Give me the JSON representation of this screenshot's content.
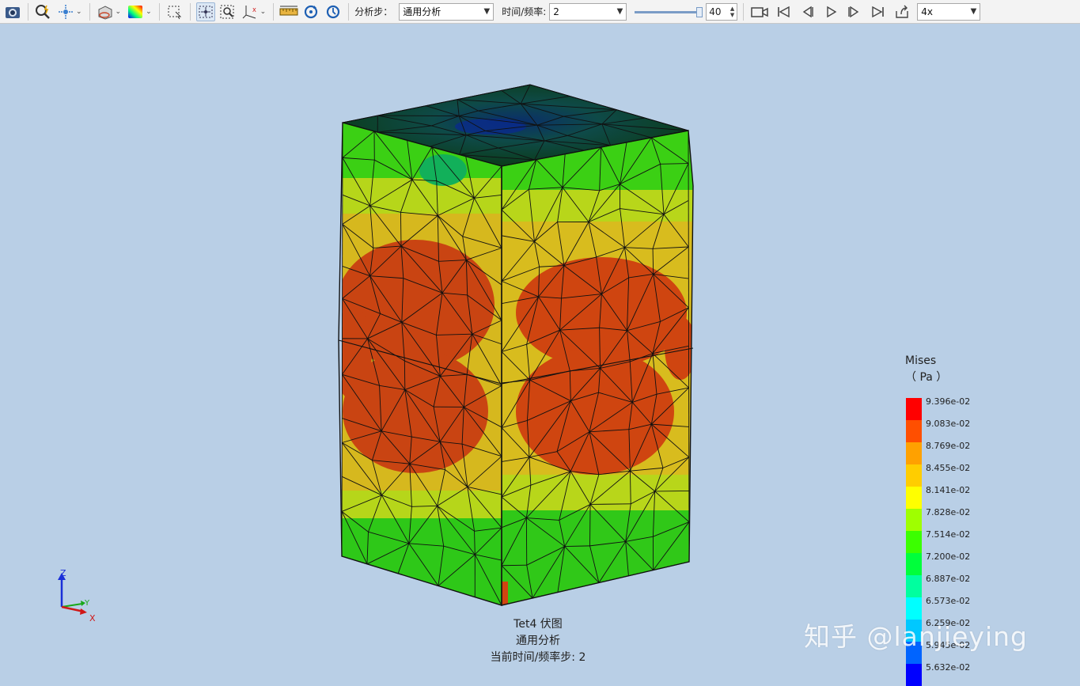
{
  "toolbar": {
    "analysis_step_label": "分析步：",
    "analysis_step_value": "通用分析",
    "time_freq_label": "时间/频率:",
    "time_freq_value": "2",
    "frame_count": "40",
    "frame_progress": 0.95,
    "speed_value": "4x"
  },
  "legend": {
    "title": "Mises",
    "unit": "（ Pa ）",
    "entries": [
      {
        "label": "9.396e-02",
        "color": "#ff0000"
      },
      {
        "label": "9.083e-02",
        "color": "#ff4f00"
      },
      {
        "label": "8.769e-02",
        "color": "#ffa100"
      },
      {
        "label": "8.455e-02",
        "color": "#ffcd00"
      },
      {
        "label": "8.141e-02",
        "color": "#ffff00"
      },
      {
        "label": "7.828e-02",
        "color": "#9fff00"
      },
      {
        "label": "7.514e-02",
        "color": "#3bff00"
      },
      {
        "label": "7.200e-02",
        "color": "#00ff3b"
      },
      {
        "label": "6.887e-02",
        "color": "#00ff9f"
      },
      {
        "label": "6.573e-02",
        "color": "#00ffff"
      },
      {
        "label": "6.259e-02",
        "color": "#00c8ff"
      },
      {
        "label": "5.945e-02",
        "color": "#0064ff"
      },
      {
        "label": "5.632e-02",
        "color": "#0000ff"
      }
    ]
  },
  "caption": {
    "line1": "Tet4  伏图",
    "line2": "通用分析",
    "line3": "当前时间/频率步:  2"
  },
  "axes": {
    "x": "X",
    "y": "Y",
    "z": "Z"
  },
  "watermark": "知乎 @lanjieying"
}
